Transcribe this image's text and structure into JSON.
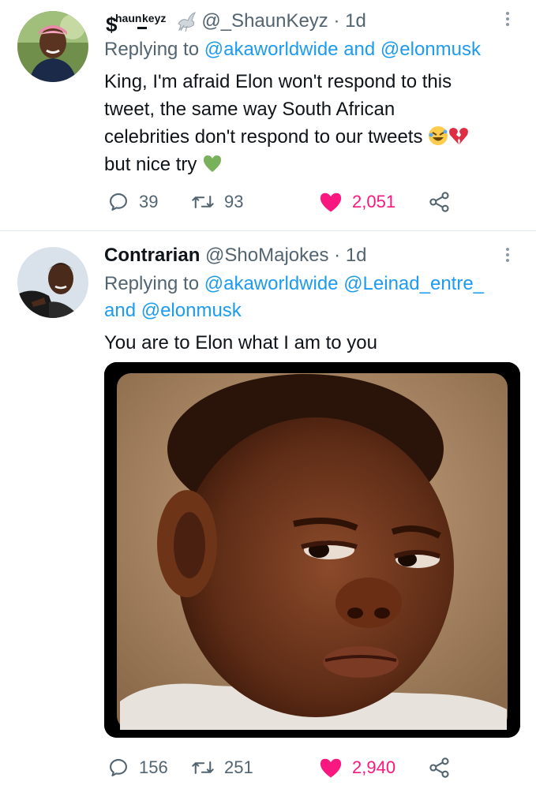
{
  "tweets": [
    {
      "display_name_parts": {
        "dollar": "$",
        "left": "haun",
        "right": "keyz",
        "dash": "_"
      },
      "handle": "@_ShaunKeyz",
      "separator": "·",
      "time": "1d",
      "replying_label": "Replying to",
      "replying_mentions_text": "@akaworldwide and @elonmusk",
      "text_lines": [
        "King, I'm afraid Elon won't respond to this",
        "tweet, the same way South African",
        "celebrities don't respond to our tweets",
        "but nice try"
      ],
      "emojis": [
        "rolling-on-floor-laughing-emoji",
        "broken-heart-emoji",
        "green-heart-emoji"
      ],
      "stats": {
        "replies": "39",
        "retweets": "93",
        "likes": "2,051"
      }
    },
    {
      "display_name": "Contrarian",
      "handle": "@ShoMajokes",
      "separator": "·",
      "time": "1d",
      "replying_label": "Replying to",
      "replying_mentions_line1": "@akaworldwide @Leinad_entre_",
      "replying_mentions_line2": "and @elonmusk",
      "text": "You are to Elon what I am to you",
      "media_description_icon": "child-side-eye-meme-image",
      "stats": {
        "replies": "156",
        "retweets": "251",
        "likes": "2,940"
      }
    }
  ],
  "icons": {
    "reply": "reply-icon",
    "retweet": "retweet-icon",
    "like": "heart-icon",
    "share": "share-icon",
    "more": "more-options-icon"
  },
  "colors": {
    "text": "#0f1419",
    "secondary": "#536471",
    "link": "#1d9bf0",
    "like": "#f91880",
    "divider": "#e1e8ed"
  }
}
